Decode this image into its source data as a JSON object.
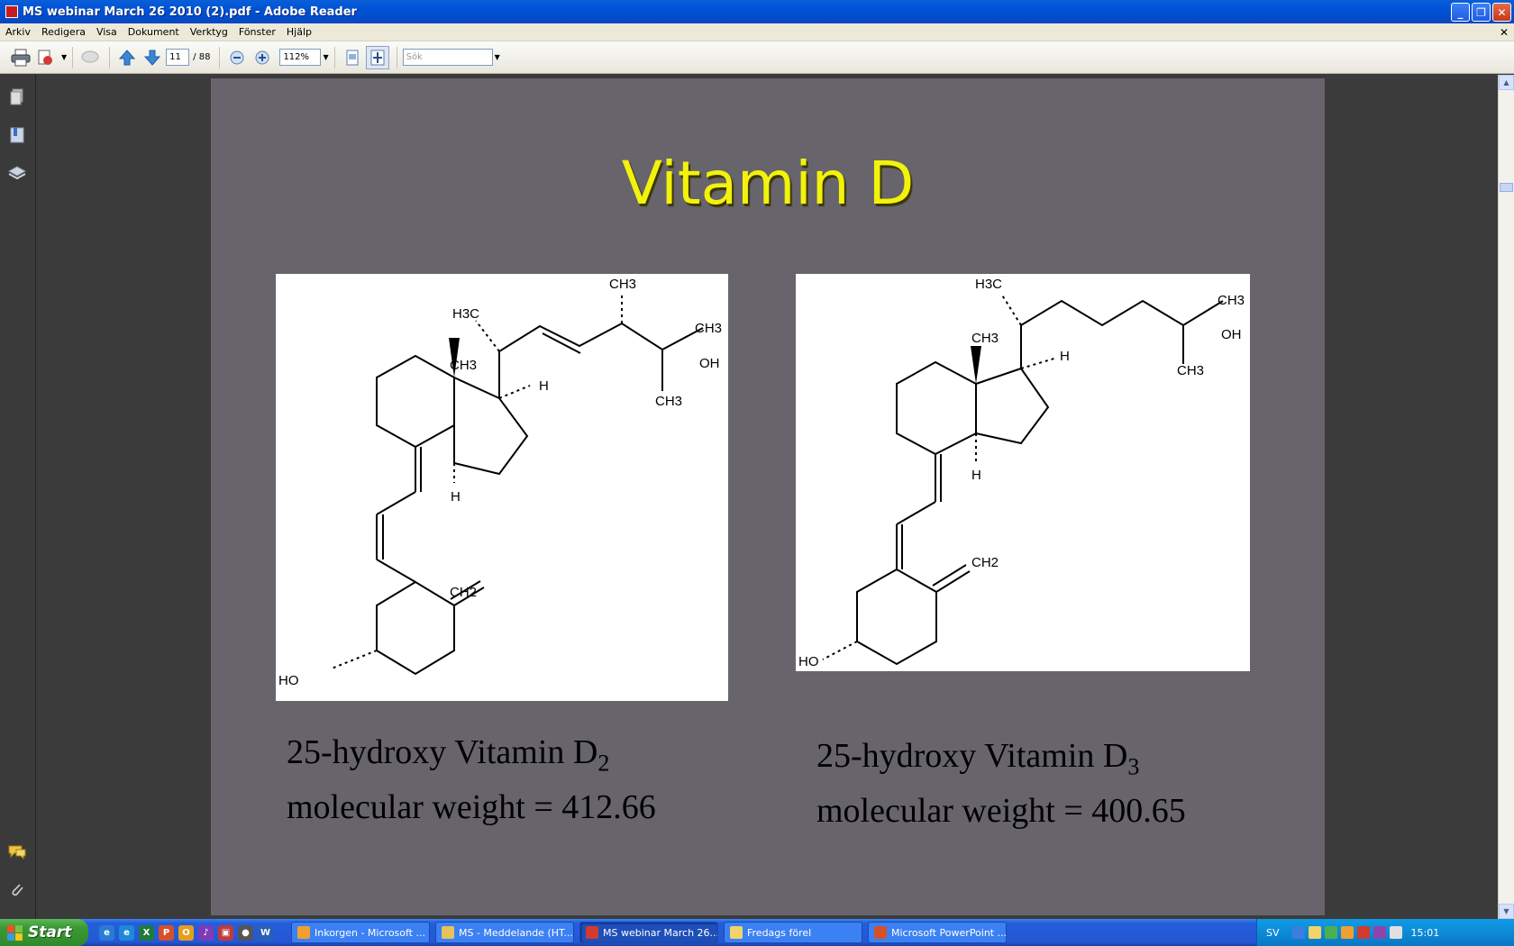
{
  "window": {
    "title": "MS webinar March 26 2010 (2).pdf - Adobe Reader",
    "buttons": [
      "minimize",
      "restore",
      "close"
    ]
  },
  "menubar": {
    "items": [
      "Arkiv",
      "Redigera",
      "Visa",
      "Dokument",
      "Verktyg",
      "Fönster",
      "Hjälp"
    ],
    "close_symbol": "✕"
  },
  "toolbar": {
    "page_current": "11",
    "page_total": "/ 88",
    "zoom": "112%",
    "search_placeholder": "Sök"
  },
  "slide": {
    "title": "Vitamin D",
    "molecule_left": {
      "labels": {
        "h3c": "H3C",
        "ch3_top": "CH3",
        "ch3_right": "CH3",
        "oh": "OH",
        "ch3_bottom": "CH3",
        "ch3_ring": "CH3",
        "h_upper": "H",
        "h_lower": "H",
        "ch2": "CH2",
        "ho": "HO"
      }
    },
    "molecule_right": {
      "labels": {
        "h3c": "H3C",
        "ch3_right": "CH3",
        "oh": "OH",
        "ch3_bottom": "CH3",
        "ch3_ring": "CH3",
        "h_upper": "H",
        "h_lower": "H",
        "ch2": "CH2",
        "ho": "HO"
      }
    },
    "caption_left": {
      "name": "25-hydroxy Vitamin D",
      "subscript": "2",
      "weight": "molecular weight = 412.66"
    },
    "caption_right": {
      "name": "25-hydroxy Vitamin D",
      "subscript": "3",
      "weight": "molecular weight = 400.65"
    }
  },
  "taskbar": {
    "start_label": "Start",
    "tasks": [
      {
        "label": "Inkorgen - Microsoft ...",
        "active": false
      },
      {
        "label": "MS - Meddelande (HT...",
        "active": false
      },
      {
        "label": "MS webinar March 26...",
        "active": true
      },
      {
        "label": "Fredags förel",
        "active": false
      },
      {
        "label": "Microsoft PowerPoint ...",
        "active": false
      }
    ],
    "language": "SV",
    "clock": "15:01"
  },
  "colors": {
    "slide_bg": "#67646c",
    "title_yellow": "#f2f20c",
    "titlebar_blue": "#0052d6",
    "taskbar_blue": "#245edb",
    "start_green": "#3c9a35"
  }
}
